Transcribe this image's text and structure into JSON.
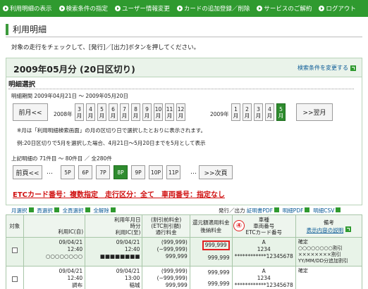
{
  "nav": [
    "利用明細の表示",
    "検索条件の指定",
    "ユーザー情報変更",
    "カードの追加登録／削除",
    "サービスのご解約",
    "ログアウト"
  ],
  "page_title": "利用明細",
  "instruction": "対象の走行をチェックして、[発行]／[出力]ボタンを押してください。",
  "period": {
    "title": "2009年05月分 (20日区切り)",
    "search_change": "検索条件を変更する"
  },
  "selection": {
    "heading": "明細選択",
    "range": "明細期間 2009年04月21日 〜 2009年05月20日",
    "prev_month": "前月<<",
    "next_month": ">>翌月",
    "year1": "2008年",
    "year2": "2009年",
    "months_2008": [
      "3",
      "4",
      "5",
      "6",
      "7",
      "8",
      "9",
      "10",
      "11",
      "12"
    ],
    "months_2009": [
      "1",
      "2",
      "3",
      "4",
      "5"
    ],
    "month_suffix": "月",
    "active_month": "5",
    "note1": "※月は「利用明細検索画面」の月の区切り日で選択したとおりに表示されます。",
    "note2": "例:20日区切りで5月を選択した場合、4月21日〜5月20日までを5月として表示"
  },
  "paging": {
    "count_text": "上記明細の 71件目 〜 80件目 ／ 全280件",
    "prev_page": "前頁<<",
    "dots": "…",
    "pages": [
      "5P",
      "6P",
      "7P",
      "8P",
      "9P",
      "10P",
      "11P"
    ],
    "active_page": "8P",
    "dots2": "…",
    "next_page": ">>次頁"
  },
  "filter_summary": "ETCカード番号：複数指定　走行区分：全て　車両番号：指定なし",
  "actions": {
    "month_select": "月選択",
    "page_select": "頁選択",
    "all_select": "全頁選択",
    "clear_all": "全解除",
    "issue_output": "発行／出力",
    "statement_pdf": "証明書PDF",
    "detail_pdf": "明細PDF",
    "detail_csv": "明細CSV"
  },
  "table": {
    "headers": {
      "target": "対象",
      "use_ic": "利用IC(自)",
      "date_time": "利用年月日",
      "time_label": "時分",
      "use_ic_to": "利用IC(至)",
      "pre_discount": "(割引前料金)",
      "etc_discount": "(ETC割引額)",
      "toll": "通行料金",
      "refund": "還元額適用料金",
      "post_refund": "後納料金",
      "vehicle": "車種",
      "vehicle_no": "車両番号",
      "card_no": "ETCカード番号",
      "remarks": "備考",
      "remarks_link": "表示内容の説明"
    },
    "rows": [
      {
        "from_date": "09/04/21",
        "from_time": "12:40",
        "from_ic": "○○○○○○○○",
        "to_date": "09/04/21",
        "to_time": "12:40",
        "to_ic": "■■■■■■■■",
        "pre": "(999,999)",
        "disc": "(−999,999)",
        "toll": "999,999",
        "refund": "999,999",
        "post": "999,999",
        "type": "A",
        "vno": "1234",
        "card": "************12345678",
        "remark1": "確定",
        "remark2": "○○○○○○○○割引",
        "remark3": "××××××××割引",
        "remark4": "YY/MM/DD分追加割引"
      },
      {
        "from_date": "09/04/21",
        "from_time": "12:40",
        "from_ic": "調布",
        "to_date": "09/04/21",
        "to_time": "13:00",
        "to_ic": "稲城",
        "pre": "(999,999)",
        "disc": "(−999,999)",
        "toll": "999,999",
        "refund": "999,999",
        "post": "999,999",
        "type": "A",
        "vno": "1234",
        "card": "************12345678",
        "remark1": "確定"
      }
    ]
  },
  "callout_label": "④",
  "colors": {
    "nav_green": "#2f9a2f",
    "active_green": "#2e8b2e",
    "alert_red": "#e02020",
    "link_blue": "#0a5a96"
  }
}
